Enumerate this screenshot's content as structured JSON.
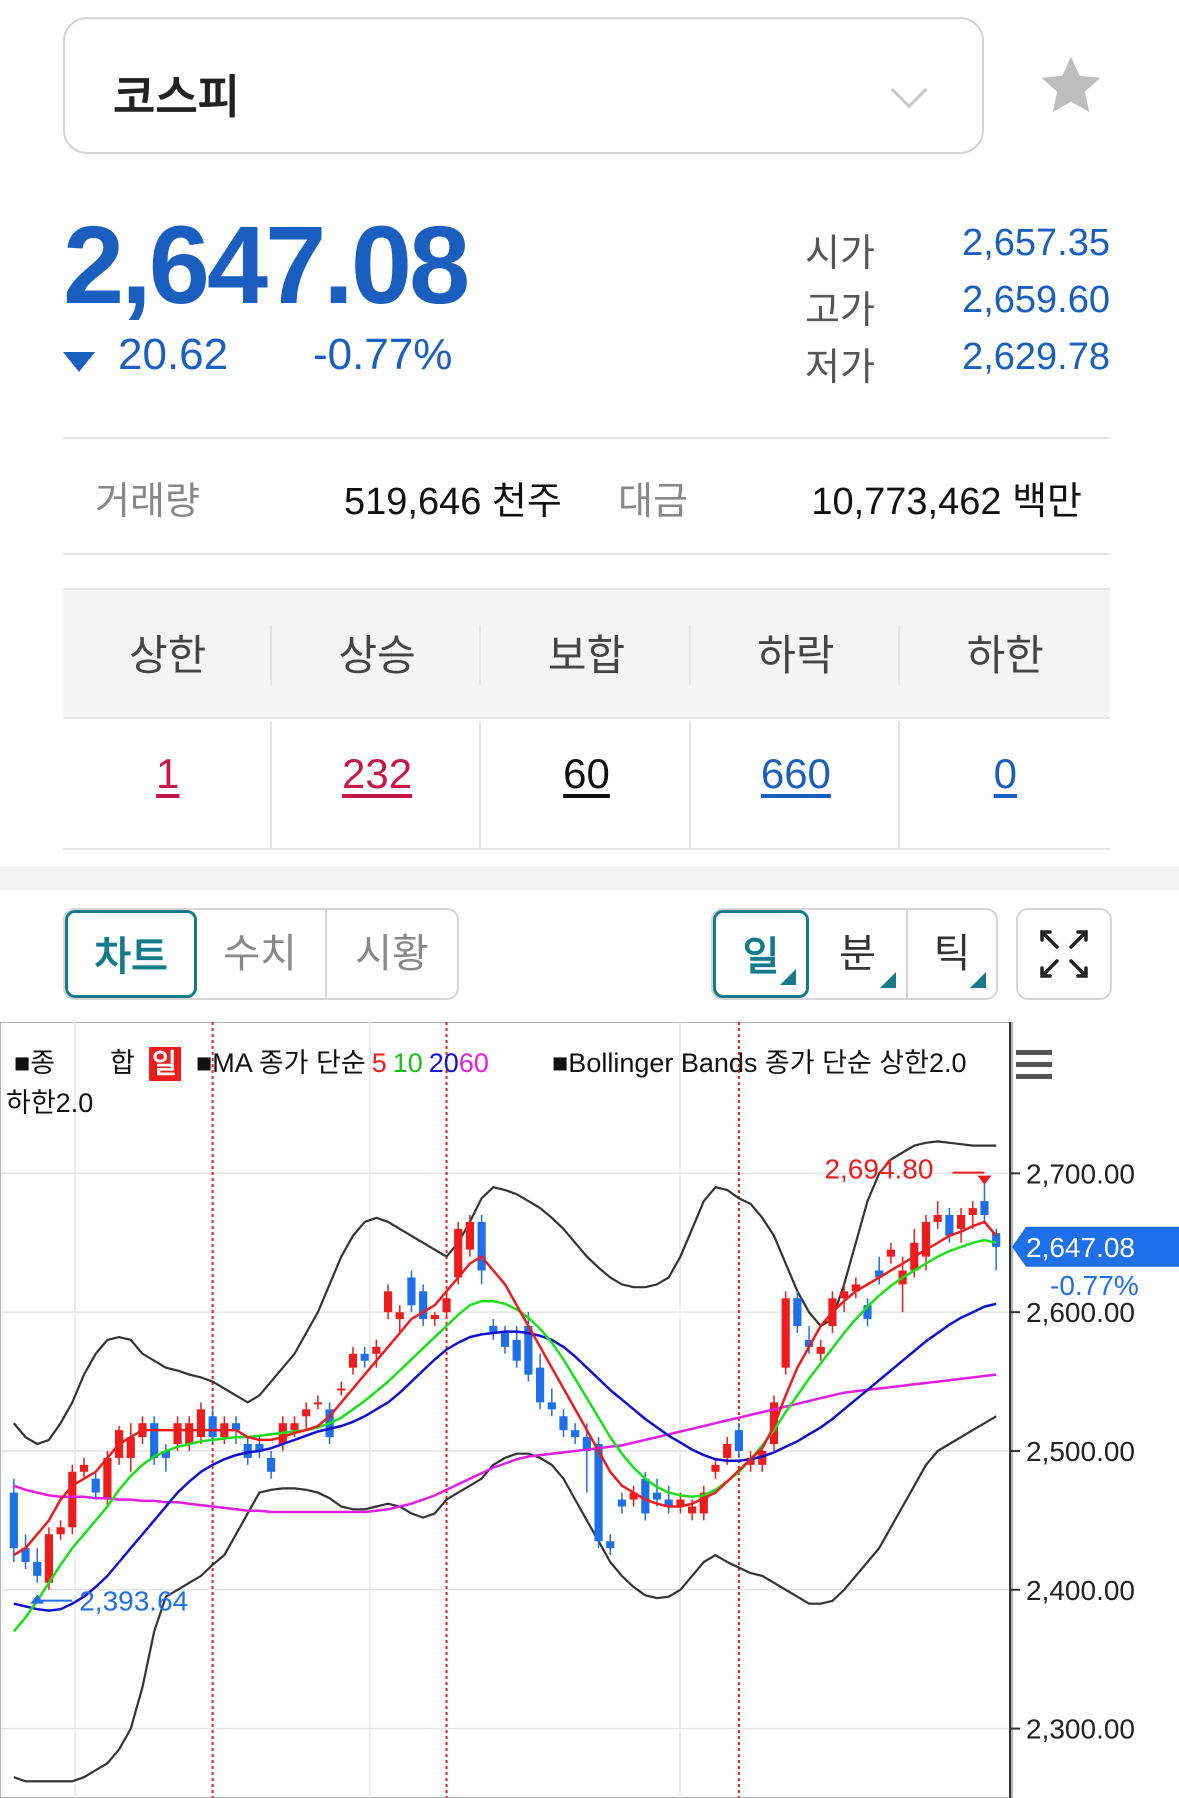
{
  "index": {
    "name": "코스피"
  },
  "quote": {
    "price": "2,647.08",
    "change": "20.62",
    "change_pct": "-0.77%",
    "open_label": "시가",
    "open": "2,657.35",
    "high_label": "고가",
    "high": "2,659.60",
    "low_label": "저가",
    "low": "2,629.78"
  },
  "volume": {
    "label": "거래량",
    "value": "519,646 천주",
    "amount_label": "대금",
    "amount": "10,773,462 백만"
  },
  "breadth": {
    "headers": [
      "상한",
      "상승",
      "보합",
      "하락",
      "하한"
    ],
    "values": [
      "1",
      "232",
      "60",
      "660",
      "0"
    ],
    "colors": [
      "#c8174a",
      "#c8174a",
      "#111111",
      "#1a5fbf",
      "#1a5fbf"
    ]
  },
  "tabs": [
    "차트",
    "수치",
    "시황"
  ],
  "periods": [
    "일",
    "분",
    "틱"
  ],
  "legend": {
    "line1_a": "■종",
    "line1_b": "합",
    "line1_day": "일",
    "ma_prefix": "■MA 종가 단순",
    "ma5": "5",
    "ma10": "10",
    "ma20": "20",
    "ma60": "60",
    "bb": "■Bollinger Bands 종가 단순 상한2.0",
    "line2": "하한2.0"
  },
  "colors": {
    "up": "#ee1c1c",
    "down": "#1f6fe8",
    "ma5": "#ee1c1c",
    "ma10": "#19e019",
    "ma20": "#1010d0",
    "ma60": "#e11ee1",
    "bb": "#333333",
    "accent": "#157a8a",
    "price_blue": "#1a5fbf"
  },
  "chart_data": {
    "type": "candlestick",
    "y_ticks": [
      "2,700.00",
      "2,600.00",
      "2,500.00",
      "2,400.00",
      "2,300.00"
    ],
    "y_tick_values": [
      2700,
      2600,
      2500,
      2400,
      2300
    ],
    "ylim": [
      2250,
      2755
    ],
    "current_price": "2,647.08",
    "current_change": "-0.77%",
    "max_label": "2,694.80",
    "min_label": "2,393.64",
    "candles": [
      [
        2470,
        2480,
        2420,
        2430
      ],
      [
        2430,
        2440,
        2415,
        2420
      ],
      [
        2420,
        2430,
        2405,
        2410
      ],
      [
        2405,
        2445,
        2400,
        2440
      ],
      [
        2440,
        2450,
        2436,
        2445
      ],
      [
        2445,
        2490,
        2440,
        2485
      ],
      [
        2485,
        2495,
        2480,
        2490
      ],
      [
        2480,
        2485,
        2465,
        2470
      ],
      [
        2465,
        2500,
        2460,
        2495
      ],
      [
        2495,
        2518,
        2490,
        2515
      ],
      [
        2495,
        2520,
        2485,
        2510
      ],
      [
        2510,
        2525,
        2505,
        2520
      ],
      [
        2520,
        2525,
        2490,
        2495
      ],
      [
        2500,
        2505,
        2485,
        2495
      ],
      [
        2505,
        2525,
        2500,
        2520
      ],
      [
        2505,
        2525,
        2500,
        2520
      ],
      [
        2510,
        2535,
        2505,
        2530
      ],
      [
        2525,
        2530,
        2505,
        2510
      ],
      [
        2510,
        2525,
        2505,
        2520
      ],
      [
        2520,
        2525,
        2505,
        2515
      ],
      [
        2505,
        2510,
        2490,
        2495
      ],
      [
        2505,
        2510,
        2495,
        2500
      ],
      [
        2495,
        2500,
        2480,
        2485
      ],
      [
        2505,
        2525,
        2500,
        2520
      ],
      [
        2515,
        2525,
        2510,
        2520
      ],
      [
        2525,
        2535,
        2515,
        2530
      ],
      [
        2535,
        2540,
        2530,
        2535
      ],
      [
        2530,
        2535,
        2505,
        2510
      ],
      [
        2545,
        2550,
        2540,
        2545
      ],
      [
        2560,
        2575,
        2555,
        2570
      ],
      [
        2570,
        2575,
        2560,
        2565
      ],
      [
        2570,
        2580,
        2560,
        2575
      ],
      [
        2600,
        2620,
        2595,
        2615
      ],
      [
        2595,
        2605,
        2585,
        2600
      ],
      [
        2625,
        2630,
        2600,
        2605
      ],
      [
        2615,
        2620,
        2590,
        2595
      ],
      [
        2595,
        2600,
        2590,
        2598
      ],
      [
        2600,
        2615,
        2595,
        2610
      ],
      [
        2625,
        2665,
        2620,
        2660
      ],
      [
        2645,
        2670,
        2640,
        2665
      ],
      [
        2665,
        2670,
        2620,
        2630
      ],
      [
        2590,
        2595,
        2580,
        2585
      ],
      [
        2585,
        2590,
        2570,
        2575
      ],
      [
        2580,
        2590,
        2560,
        2565
      ],
      [
        2590,
        2600,
        2550,
        2555
      ],
      [
        2560,
        2570,
        2530,
        2535
      ],
      [
        2535,
        2545,
        2525,
        2530
      ],
      [
        2525,
        2530,
        2510,
        2515
      ],
      [
        2515,
        2520,
        2505,
        2510
      ],
      [
        2510,
        2520,
        2470,
        2500
      ],
      [
        2505,
        2510,
        2430,
        2435
      ],
      [
        2435,
        2440,
        2425,
        2430
      ],
      [
        2465,
        2470,
        2455,
        2460
      ],
      [
        2465,
        2475,
        2460,
        2470
      ],
      [
        2480,
        2485,
        2450,
        2455
      ],
      [
        2470,
        2480,
        2460,
        2465
      ],
      [
        2465,
        2475,
        2455,
        2460
      ],
      [
        2460,
        2470,
        2455,
        2465
      ],
      [
        2455,
        2465,
        2450,
        2460
      ],
      [
        2455,
        2475,
        2450,
        2470
      ],
      [
        2485,
        2495,
        2480,
        2490
      ],
      [
        2495,
        2510,
        2490,
        2505
      ],
      [
        2515,
        2520,
        2495,
        2500
      ],
      [
        2490,
        2500,
        2485,
        2495
      ],
      [
        2490,
        2505,
        2485,
        2500
      ],
      [
        2505,
        2540,
        2500,
        2535
      ],
      [
        2560,
        2615,
        2555,
        2610
      ],
      [
        2610,
        2615,
        2585,
        2590
      ],
      [
        2580,
        2590,
        2570,
        2575
      ],
      [
        2570,
        2580,
        2565,
        2575
      ],
      [
        2590,
        2615,
        2585,
        2610
      ],
      [
        2610,
        2620,
        2600,
        2615
      ],
      [
        2615,
        2625,
        2610,
        2620
      ],
      [
        2605,
        2610,
        2590,
        2595
      ],
      [
        2630,
        2640,
        2620,
        2625
      ],
      [
        2640,
        2650,
        2635,
        2645
      ],
      [
        2620,
        2640,
        2600,
        2630
      ],
      [
        2630,
        2660,
        2625,
        2650
      ],
      [
        2640,
        2670,
        2630,
        2665
      ],
      [
        2665,
        2680,
        2660,
        2670
      ],
      [
        2670,
        2675,
        2650,
        2655
      ],
      [
        2660,
        2675,
        2650,
        2670
      ],
      [
        2670,
        2680,
        2660,
        2675
      ],
      [
        2680,
        2695,
        2665,
        2670
      ],
      [
        2657,
        2660,
        2630,
        2647
      ]
    ],
    "ma5": [
      2425,
      2430,
      2440,
      2450,
      2465,
      2475,
      2480,
      2485,
      2495,
      2505,
      2510,
      2515,
      2515,
      2515,
      2515,
      2515,
      2515,
      2515,
      2515,
      2515,
      2510,
      2508,
      2508,
      2510,
      2513,
      2515,
      2518,
      2525,
      2535,
      2545,
      2555,
      2565,
      2575,
      2585,
      2595,
      2600,
      2605,
      2615,
      2625,
      2635,
      2640,
      2630,
      2620,
      2605,
      2590,
      2575,
      2560,
      2545,
      2530,
      2515,
      2500,
      2485,
      2475,
      2470,
      2465,
      2462,
      2460,
      2460,
      2462,
      2466,
      2470,
      2478,
      2486,
      2494,
      2502,
      2518,
      2540,
      2560,
      2575,
      2590,
      2600,
      2608,
      2615,
      2620,
      2625,
      2630,
      2635,
      2640,
      2645,
      2650,
      2655,
      2658,
      2662,
      2665,
      2655
    ],
    "ma10": [
      2370,
      2380,
      2392,
      2405,
      2418,
      2430,
      2440,
      2450,
      2460,
      2472,
      2482,
      2490,
      2496,
      2500,
      2503,
      2505,
      2507,
      2508,
      2509,
      2510,
      2510,
      2511,
      2512,
      2513,
      2514,
      2515,
      2517,
      2520,
      2524,
      2530,
      2536,
      2543,
      2550,
      2558,
      2566,
      2574,
      2582,
      2590,
      2598,
      2605,
      2608,
      2608,
      2606,
      2602,
      2596,
      2588,
      2578,
      2566,
      2552,
      2538,
      2524,
      2510,
      2498,
      2488,
      2480,
      2474,
      2470,
      2468,
      2467,
      2468,
      2472,
      2478,
      2485,
      2494,
      2504,
      2515,
      2528,
      2540,
      2552,
      2563,
      2574,
      2585,
      2595,
      2604,
      2612,
      2619,
      2625,
      2630,
      2635,
      2640,
      2644,
      2647,
      2650,
      2652,
      2650
    ],
    "ma20": [
      2390,
      2388,
      2386,
      2385,
      2386,
      2390,
      2395,
      2402,
      2410,
      2420,
      2430,
      2440,
      2450,
      2460,
      2470,
      2478,
      2485,
      2490,
      2494,
      2497,
      2499,
      2500,
      2502,
      2505,
      2508,
      2511,
      2514,
      2516,
      2518,
      2521,
      2525,
      2530,
      2535,
      2542,
      2550,
      2558,
      2566,
      2573,
      2578,
      2582,
      2584,
      2585,
      2586,
      2586,
      2585,
      2583,
      2580,
      2575,
      2568,
      2560,
      2552,
      2544,
      2537,
      2530,
      2523,
      2517,
      2511,
      2506,
      2501,
      2497,
      2494,
      2493,
      2493,
      2494,
      2496,
      2499,
      2503,
      2507,
      2512,
      2517,
      2523,
      2530,
      2537,
      2544,
      2551,
      2558,
      2565,
      2572,
      2579,
      2585,
      2591,
      2596,
      2600,
      2604,
      2606
    ],
    "ma60": [
      2475,
      2472,
      2470,
      2468,
      2467,
      2467,
      2467,
      2466,
      2466,
      2465,
      2465,
      2464,
      2464,
      2463,
      2463,
      2462,
      2461,
      2460,
      2459,
      2458,
      2457,
      2457,
      2456,
      2456,
      2456,
      2456,
      2456,
      2456,
      2456,
      2456,
      2456,
      2457,
      2458,
      2460,
      2462,
      2465,
      2468,
      2472,
      2476,
      2480,
      2484,
      2488,
      2491,
      2494,
      2496,
      2497,
      2498,
      2499,
      2500,
      2501,
      2502,
      2503,
      2504,
      2506,
      2508,
      2510,
      2512,
      2514,
      2516,
      2518,
      2520,
      2522,
      2524,
      2526,
      2528,
      2530,
      2532,
      2534,
      2536,
      2538,
      2540,
      2542,
      2543,
      2544,
      2545,
      2546,
      2547,
      2548,
      2549,
      2550,
      2551,
      2552,
      2553,
      2554,
      2555
    ],
    "bb_upper": [
      2520,
      2510,
      2505,
      2508,
      2520,
      2535,
      2555,
      2570,
      2580,
      2582,
      2580,
      2570,
      2565,
      2560,
      2558,
      2555,
      2553,
      2550,
      2545,
      2540,
      2535,
      2540,
      2550,
      2560,
      2570,
      2585,
      2600,
      2620,
      2640,
      2655,
      2665,
      2668,
      2665,
      2660,
      2655,
      2650,
      2645,
      2640,
      2650,
      2665,
      2682,
      2690,
      2688,
      2685,
      2680,
      2675,
      2668,
      2660,
      2650,
      2640,
      2632,
      2625,
      2620,
      2618,
      2618,
      2620,
      2625,
      2640,
      2660,
      2680,
      2690,
      2688,
      2682,
      2678,
      2668,
      2655,
      2635,
      2615,
      2600,
      2590,
      2595,
      2620,
      2650,
      2680,
      2700,
      2710,
      2715,
      2720,
      2722,
      2723,
      2722,
      2721,
      2720,
      2720,
      2720
    ],
    "bb_lower": [
      2265,
      2262,
      2262,
      2262,
      2262,
      2262,
      2265,
      2270,
      2275,
      2285,
      2300,
      2330,
      2370,
      2395,
      2400,
      2405,
      2410,
      2418,
      2425,
      2440,
      2455,
      2470,
      2472,
      2473,
      2473,
      2472,
      2470,
      2466,
      2460,
      2458,
      2458,
      2460,
      2462,
      2460,
      2455,
      2452,
      2455,
      2465,
      2470,
      2475,
      2480,
      2490,
      2495,
      2498,
      2498,
      2495,
      2490,
      2480,
      2465,
      2450,
      2435,
      2420,
      2410,
      2402,
      2396,
      2394,
      2395,
      2400,
      2410,
      2420,
      2425,
      2420,
      2416,
      2412,
      2410,
      2405,
      2400,
      2395,
      2390,
      2390,
      2392,
      2400,
      2410,
      2420,
      2430,
      2445,
      2460,
      2475,
      2490,
      2500,
      2505,
      2510,
      2515,
      2520,
      2525
    ],
    "cursor_lines_at": [
      17,
      37,
      62
    ]
  }
}
